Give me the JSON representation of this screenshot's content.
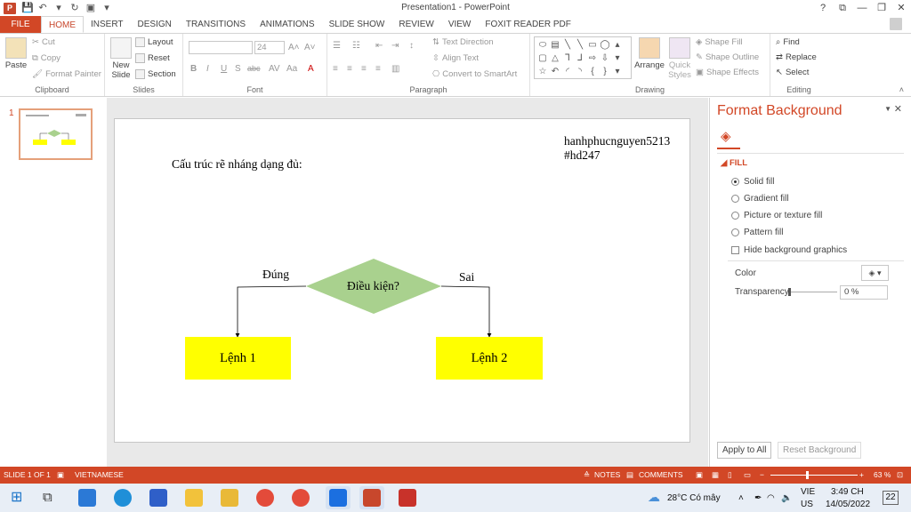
{
  "window": {
    "title": "Presentation1 - PowerPoint",
    "logo": "P"
  },
  "tabs": [
    "FILE",
    "HOME",
    "INSERT",
    "DESIGN",
    "TRANSITIONS",
    "ANIMATIONS",
    "SLIDE SHOW",
    "REVIEW",
    "VIEW",
    "FOXIT READER PDF"
  ],
  "ribbon": {
    "clipboard": {
      "label": "Clipboard",
      "paste": "Paste",
      "cut": "Cut",
      "copy": "Copy",
      "format_painter": "Format Painter"
    },
    "slides": {
      "label": "Slides",
      "new_slide_1": "New",
      "new_slide_2": "Slide",
      "layout": "Layout",
      "reset": "Reset",
      "section": "Section"
    },
    "font": {
      "label": "Font",
      "size": "24"
    },
    "paragraph": {
      "label": "Paragraph",
      "text_direction": "Text Direction",
      "align_text": "Align Text",
      "convert_smartart": "Convert to SmartArt"
    },
    "drawing": {
      "label": "Drawing",
      "arrange": "Arrange",
      "quick_styles_1": "Quick",
      "quick_styles_2": "Styles",
      "shape_fill": "Shape Fill",
      "shape_outline": "Shape Outline",
      "shape_effects": "Shape Effects"
    },
    "editing": {
      "label": "Editing",
      "find": "Find",
      "replace": "Replace",
      "select": "Select"
    }
  },
  "thumbnails": [
    {
      "number": "1"
    }
  ],
  "slide": {
    "heading": "Cấu trúc rẽ nháng dạng đủ:",
    "author_line1": "hanhphucnguyen5213",
    "author_line2": "#hd247",
    "decision": "Điều kiện?",
    "branch_true": "Đúng",
    "branch_false": "Sai",
    "box_left": "Lệnh 1",
    "box_right": "Lệnh 2",
    "colors": {
      "diamond": "#a9d18e",
      "boxes": "#ffff00"
    }
  },
  "format_pane": {
    "title": "Format Background",
    "section": "FILL",
    "options": [
      "Solid fill",
      "Gradient fill",
      "Picture or texture fill",
      "Pattern fill"
    ],
    "selected_option": "Solid fill",
    "hide_graphics": "Hide background graphics",
    "color_label": "Color",
    "transparency_label": "Transparency",
    "transparency_value": "0 %",
    "apply_all": "Apply to All",
    "reset_background": "Reset Background"
  },
  "status": {
    "slide_info": "SLIDE 1 OF 1",
    "language": "VIETNAMESE",
    "notes": "NOTES",
    "comments": "COMMENTS",
    "zoom": "63 %"
  },
  "taskbar": {
    "weather": "28°C  Có mây",
    "lang_1": "VIE",
    "lang_2": "US",
    "time": "3:49 CH",
    "date": "14/05/2022",
    "notifications": "22"
  },
  "accent": "#d24726"
}
